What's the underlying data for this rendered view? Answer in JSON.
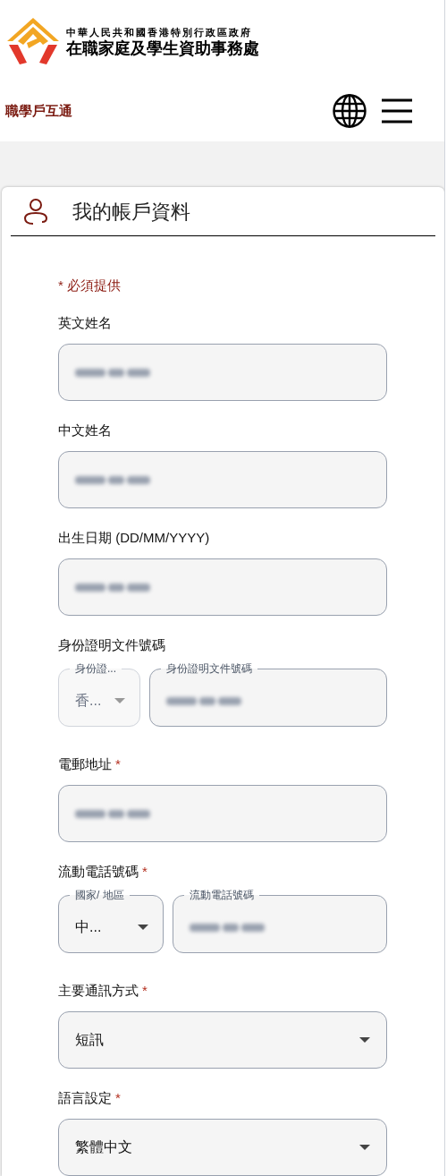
{
  "header": {
    "logo_line_1": "中華人民共和國香港特別行政區政府",
    "logo_line_2": "在職家庭及學生資助事務處",
    "site_name": "職學戶互通"
  },
  "card": {
    "title": "我的帳戶資料",
    "required_note": "* 必須提供",
    "fields": [
      {
        "kind": "text",
        "label": "英文姓名",
        "redacted": true
      },
      {
        "kind": "text",
        "label": "中文姓名",
        "redacted": true
      },
      {
        "kind": "text",
        "label": "出生日期 (DD/MM/YYYY)",
        "redacted": true
      },
      {
        "kind": "split",
        "label": "身份證明文件號碼",
        "select": {
          "label": "身份證...",
          "value": "香...",
          "disabled": true
        },
        "input": {
          "label": "身份證明文件號碼",
          "redacted": true
        }
      },
      {
        "kind": "text",
        "label": "電郵地址",
        "required_mark": "*",
        "redacted": true
      },
      {
        "kind": "split",
        "label": "流動電話號碼",
        "required_mark": "*",
        "select": {
          "label": "國家/ 地區",
          "value": "中...",
          "disabled": false
        },
        "input": {
          "label": "流動電話號碼",
          "redacted": true
        }
      },
      {
        "kind": "select",
        "label": "主要通訊方式",
        "required_mark": "*",
        "value": "短訊"
      },
      {
        "kind": "select",
        "label": "語言設定",
        "required_mark": "*",
        "value": "繁體中文"
      }
    ]
  }
}
